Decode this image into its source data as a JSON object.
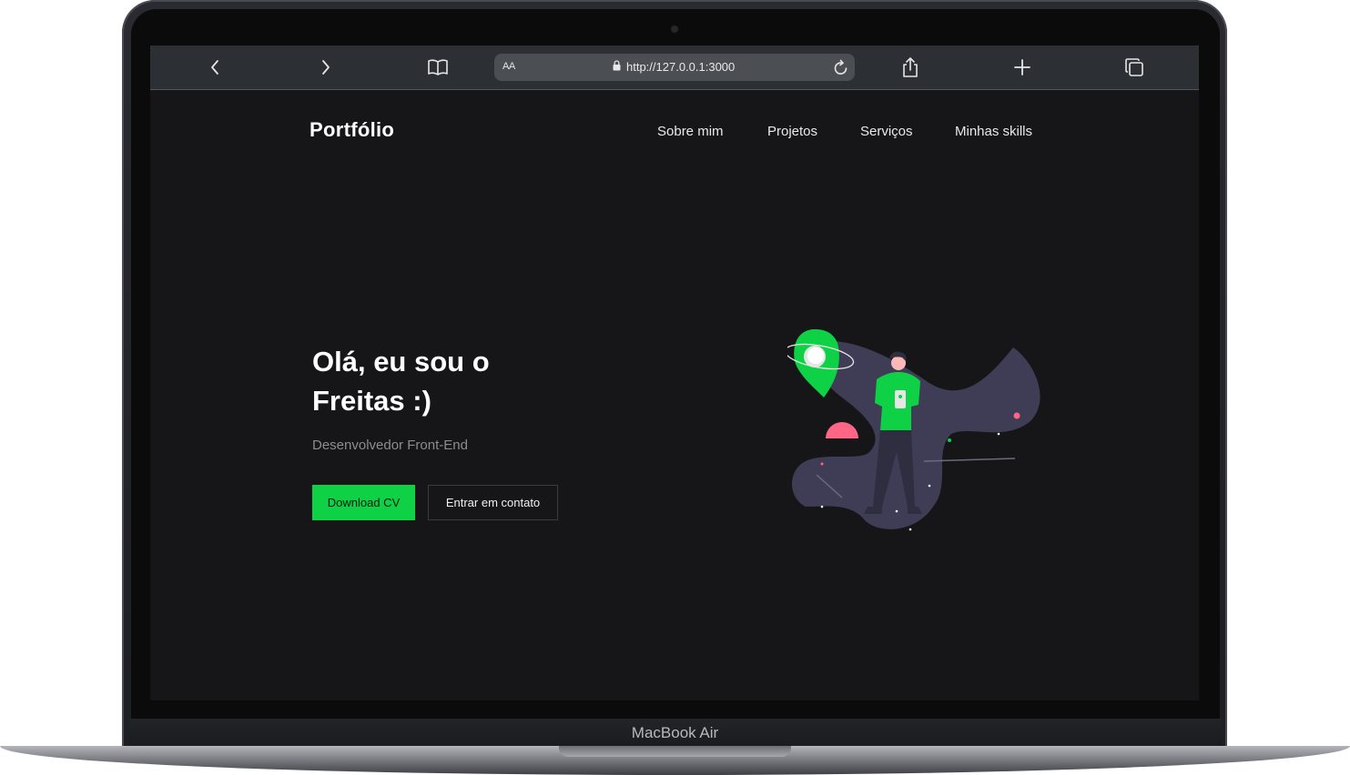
{
  "device": {
    "model_label": "MacBook Air"
  },
  "browser": {
    "text_size_label": "AA",
    "url": "http://127.0.0.1:3000",
    "icons": [
      "back-icon",
      "forward-icon",
      "bookmarks-icon",
      "lock-icon",
      "reload-icon",
      "share-icon",
      "new-tab-icon",
      "tabs-icon"
    ]
  },
  "site": {
    "brand": "Portfólio",
    "nav": [
      "Sobre mim",
      "Projetos",
      "Serviços",
      "Minhas skills"
    ],
    "hero": {
      "title": "Olá, eu sou o Freitas :)",
      "subtitle": "Desenvolvedor Front-End",
      "primary_button": "Download CV",
      "secondary_button": "Entrar em contato"
    },
    "colors": {
      "accent": "#0ed145",
      "background": "#161618",
      "illustration_path": "#3f3d56",
      "highlight": "#ff6584"
    }
  }
}
